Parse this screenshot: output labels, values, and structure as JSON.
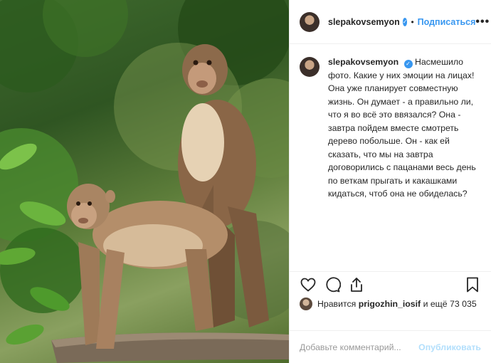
{
  "post": {
    "photo": {
      "description": ""
    },
    "header": {
      "username": "slepakovsemyon",
      "separator": "•",
      "follow_label": "Подписаться",
      "more_label": "•••"
    },
    "caption": {
      "username": "slepakovsemyon",
      "text": "Насмешило фото. Какие у них эмоции на лицах! Она уже планирует совместную жизнь. Он думает - а правильно ли, что я во всё это ввязался? Она - завтра пойдем вместе смотреть дерево побольше. Он - как ей сказать, что мы на завтра договорились с пацанами весь день по веткам прыгать и какашками кидаться, чтоб она не обиделась?"
    },
    "actions": {
      "like": "heart-icon",
      "comment": "comment-icon",
      "share": "share-icon",
      "save": "bookmark-icon"
    },
    "likes": {
      "prefix": "Нравится",
      "user": "prigozhin_iosif",
      "suffix": "и ещё 73 035"
    },
    "comment_box": {
      "placeholder": "Добавьте комментарий...",
      "publish_label": "Опубликовать"
    },
    "colors": {
      "accent": "#3897f0",
      "publish_disabled": "#b2dffc",
      "divider": "#efefef"
    }
  }
}
